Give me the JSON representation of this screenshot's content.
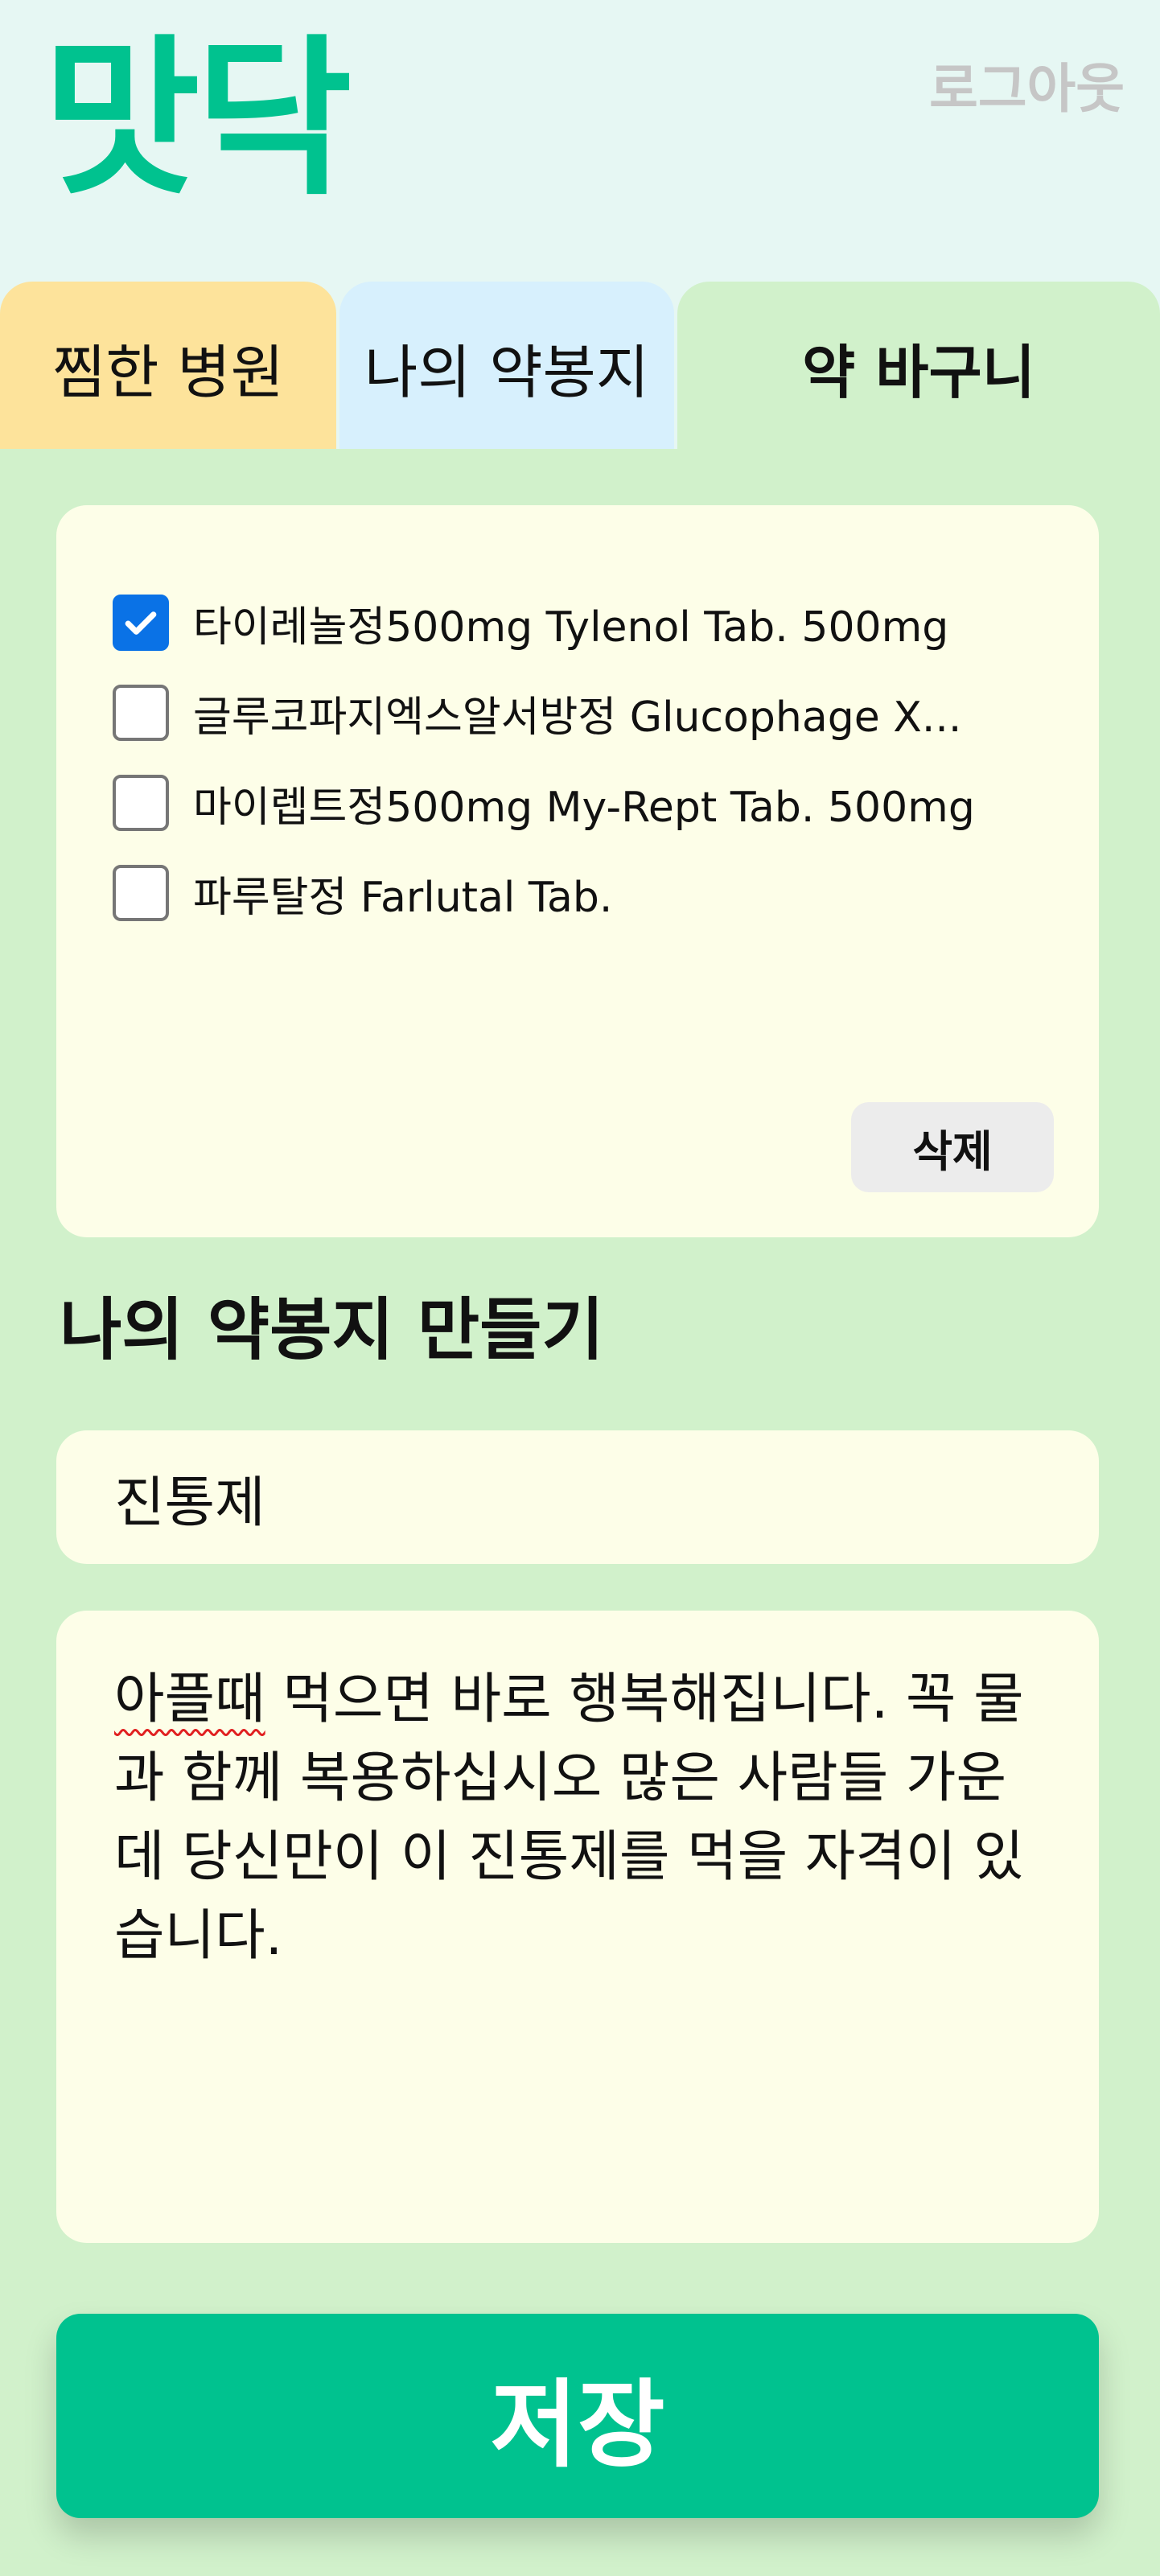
{
  "app": {
    "logo": "맛닥",
    "logout_label": "로그아웃"
  },
  "tabs": [
    {
      "label": "찜한 병원",
      "color": "#fde39b"
    },
    {
      "label": "나의 약봉지",
      "color": "#d7f0fd"
    },
    {
      "label": "약 바구니",
      "color": "#d1f1cb",
      "active": true
    }
  ],
  "basket": {
    "items": [
      {
        "name": "타이레놀정500mg Tylenol Tab. 500mg",
        "checked": true
      },
      {
        "name": "글루코파지엑스알서방정 Glucophage X...",
        "checked": false
      },
      {
        "name": "마이렙트정500mg My-Rept Tab. 500mg",
        "checked": false
      },
      {
        "name": "파루탈정 Farlutal Tab.",
        "checked": false
      }
    ],
    "delete_label": "삭제"
  },
  "create": {
    "title": "나의 약봉지 만들기",
    "name_value": "진통제",
    "desc_misspelled": "아플때",
    "desc_rest": " 먹으면 바로 행복해집니다. 꼭 물과 함께 복용하십시오 많은 사람들 가운데 당신만이 이 진통제를 먹을 자격이 있습니다.",
    "save_label": "저장"
  },
  "colors": {
    "accent": "#00c28f",
    "panel": "#d1f1cb",
    "card": "#fdfee8",
    "check": "#0a72e6"
  }
}
